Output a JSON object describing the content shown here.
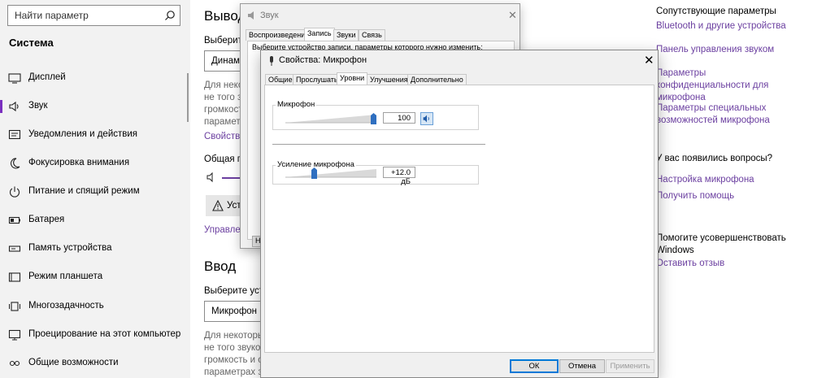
{
  "search": {
    "placeholder": "Найти параметр"
  },
  "sidebar": {
    "heading": "Система",
    "items": [
      {
        "label": "Дисплей",
        "icon": "display-icon"
      },
      {
        "label": "Звук",
        "icon": "speaker-icon",
        "active": true
      },
      {
        "label": "Уведомления и действия",
        "icon": "notification-icon"
      },
      {
        "label": "Фокусировка внимания",
        "icon": "moon-icon"
      },
      {
        "label": "Питание и спящий режим",
        "icon": "power-icon"
      },
      {
        "label": "Батарея",
        "icon": "battery-icon"
      },
      {
        "label": "Память устройства",
        "icon": "storage-icon"
      },
      {
        "label": "Режим планшета",
        "icon": "tablet-icon"
      },
      {
        "label": "Многозадачность",
        "icon": "multitask-icon"
      },
      {
        "label": "Проецирование на этот компьютер",
        "icon": "project-icon"
      },
      {
        "label": "Общие возможности",
        "icon": "shared-icon"
      }
    ]
  },
  "main": {
    "output_heading": "Вывод",
    "output_choose": "Выберите",
    "output_device": "Динами",
    "output_note": [
      "Для неко",
      "не того зв",
      "громкост",
      "параметр"
    ],
    "output_props_link": "Свойства",
    "volume_label": "Общая гр",
    "troubleshoot_label": "Уст",
    "manage_link": "Управлен",
    "input_heading": "Ввод",
    "input_choose": "Выберите устр",
    "input_device": "Микрофон (2",
    "input_note": [
      "Для некоторых",
      "не того звуков",
      "громкость и с",
      "параметрах зв"
    ]
  },
  "right_panel": {
    "related_heading": "Сопутствующие параметры",
    "related_links": [
      "Bluetooth и другие устройства",
      "Панель управления звуком",
      "Параметры конфиденциальности для микрофона",
      "Параметры специальных возможностей микрофона"
    ],
    "questions_heading": "У вас появились вопросы?",
    "question_links": [
      "Настройка микрофона",
      "Получить помощь"
    ],
    "improve_heading": "Помогите усовершенствовать Windows",
    "feedback_link": "Оставить отзыв"
  },
  "sound_window": {
    "title": "Звук",
    "tabs": [
      "Воспроизведение",
      "Запись",
      "Звуки",
      "Связь"
    ],
    "selected_tab": "Запись",
    "instruction": "Выберите устройство записи, параметры которого нужно изменить:",
    "button_stub": "Н"
  },
  "properties_window": {
    "title": "Свойства: Микрофон",
    "tabs": [
      "Общие",
      "Прослушать",
      "Уровни",
      "Улучшения",
      "Дополнительно"
    ],
    "selected_tab": "Уровни",
    "mic_label": "Микрофон",
    "mic_value": "100",
    "mic_level": 1.0,
    "boost_label": "Усиление микрофона",
    "boost_value": "+12.0 дБ",
    "boost_level": 0.3,
    "buttons": {
      "ok": "ОК",
      "cancel": "Отмена",
      "apply": "Применить"
    }
  },
  "colors": {
    "accent": "#6b3fa0",
    "selection": "#0078d7",
    "slider_thumb": "#2f6fc0"
  }
}
